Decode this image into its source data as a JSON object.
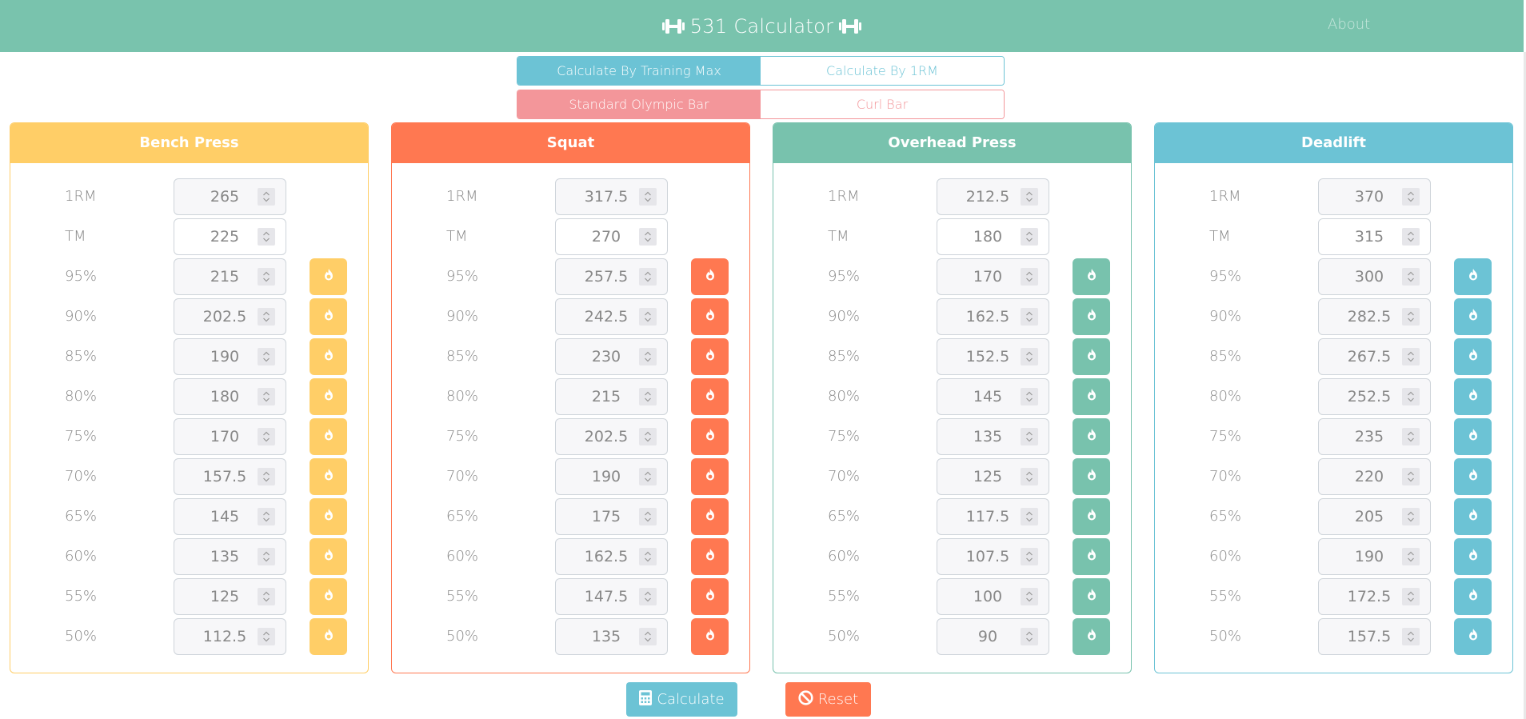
{
  "navbar": {
    "brand": "531 Calculator",
    "brand_icon": "dumbbell-icon",
    "about": "About",
    "color": "#79c3ad"
  },
  "mode_toggle": {
    "options": [
      "Calculate By Training Max",
      "Calculate By 1RM"
    ],
    "selected": "Calculate By Training Max",
    "color": "#6cc3d5"
  },
  "bar_toggle": {
    "options": [
      "Standard Olympic Bar",
      "Curl Bar"
    ],
    "selected": "Standard Olympic Bar",
    "color": "#f3969a"
  },
  "lifts": [
    {
      "name": "Bench Press",
      "color": "#ffce67",
      "one_rm_label": "1RM",
      "one_rm": "265",
      "tm_label": "TM",
      "tm": "225",
      "percentages": [
        {
          "label": "95%",
          "value": "215"
        },
        {
          "label": "90%",
          "value": "202.5"
        },
        {
          "label": "85%",
          "value": "190"
        },
        {
          "label": "80%",
          "value": "180"
        },
        {
          "label": "75%",
          "value": "170"
        },
        {
          "label": "70%",
          "value": "157.5"
        },
        {
          "label": "65%",
          "value": "145"
        },
        {
          "label": "60%",
          "value": "135"
        },
        {
          "label": "55%",
          "value": "125"
        },
        {
          "label": "50%",
          "value": "112.5"
        }
      ]
    },
    {
      "name": "Squat",
      "color": "#ff7851",
      "one_rm_label": "1RM",
      "one_rm": "317.5",
      "tm_label": "TM",
      "tm": "270",
      "percentages": [
        {
          "label": "95%",
          "value": "257.5"
        },
        {
          "label": "90%",
          "value": "242.5"
        },
        {
          "label": "85%",
          "value": "230"
        },
        {
          "label": "80%",
          "value": "215"
        },
        {
          "label": "75%",
          "value": "202.5"
        },
        {
          "label": "70%",
          "value": "190"
        },
        {
          "label": "65%",
          "value": "175"
        },
        {
          "label": "60%",
          "value": "162.5"
        },
        {
          "label": "55%",
          "value": "147.5"
        },
        {
          "label": "50%",
          "value": "135"
        }
      ]
    },
    {
      "name": "Overhead Press",
      "color": "#78c2ad",
      "one_rm_label": "1RM",
      "one_rm": "212.5",
      "tm_label": "TM",
      "tm": "180",
      "percentages": [
        {
          "label": "95%",
          "value": "170"
        },
        {
          "label": "90%",
          "value": "162.5"
        },
        {
          "label": "85%",
          "value": "152.5"
        },
        {
          "label": "80%",
          "value": "145"
        },
        {
          "label": "75%",
          "value": "135"
        },
        {
          "label": "70%",
          "value": "125"
        },
        {
          "label": "65%",
          "value": "117.5"
        },
        {
          "label": "60%",
          "value": "107.5"
        },
        {
          "label": "55%",
          "value": "100"
        },
        {
          "label": "50%",
          "value": "90"
        }
      ]
    },
    {
      "name": "Deadlift",
      "color": "#6cc3d5",
      "one_rm_label": "1RM",
      "one_rm": "370",
      "tm_label": "TM",
      "tm": "315",
      "percentages": [
        {
          "label": "95%",
          "value": "300"
        },
        {
          "label": "90%",
          "value": "282.5"
        },
        {
          "label": "85%",
          "value": "267.5"
        },
        {
          "label": "80%",
          "value": "252.5"
        },
        {
          "label": "75%",
          "value": "235"
        },
        {
          "label": "70%",
          "value": "220"
        },
        {
          "label": "65%",
          "value": "205"
        },
        {
          "label": "60%",
          "value": "190"
        },
        {
          "label": "55%",
          "value": "172.5"
        },
        {
          "label": "50%",
          "value": "157.5"
        }
      ]
    }
  ],
  "actions": {
    "calculate": {
      "label": "Calculate",
      "icon": "calculator-icon",
      "color": "#6cc3d5"
    },
    "reset": {
      "label": "Reset",
      "icon": "ban-icon",
      "color": "#ff7851"
    }
  }
}
